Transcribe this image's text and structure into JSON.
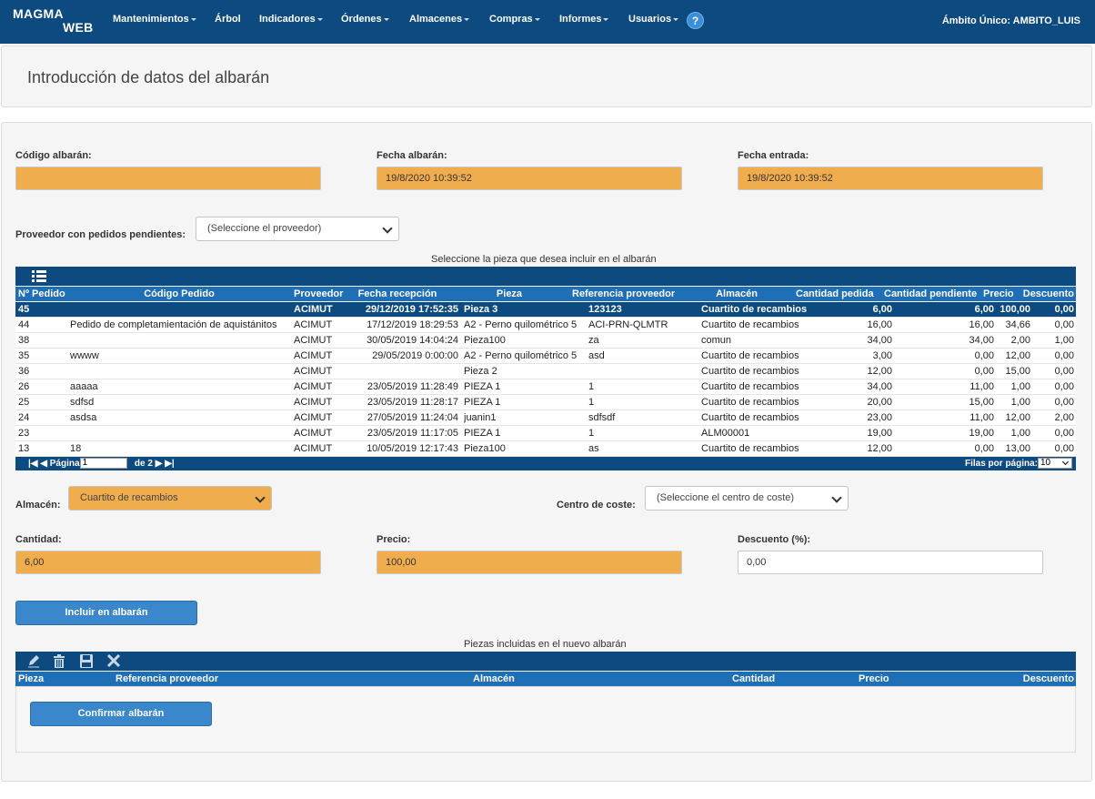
{
  "navbar": {
    "logo_line1": "MAGMA",
    "logo_line2": "WEB",
    "items": [
      "Mantenimientos",
      "Árbol",
      "Indicadores",
      "Órdenes",
      "Almacenes",
      "Compras",
      "Informes",
      "Usuarios"
    ],
    "help_label": "?",
    "scope": "Ámbito Único: AMBITO_LUIS"
  },
  "page": {
    "title": "Introducción de datos del albarán"
  },
  "form": {
    "codigo_label": "Código albarán:",
    "codigo_value": "",
    "fecha_albaran_label": "Fecha albarán:",
    "fecha_albaran_value": "19/8/2020 10:39:52",
    "fecha_entrada_label": "Fecha entrada:",
    "fecha_entrada_value": "19/8/2020 10:39:52",
    "proveedor_label": "Proveedor con pedidos pendientes:",
    "proveedor_value": "(Seleccione el proveedor)"
  },
  "pending_grid": {
    "caption": "Seleccione la pieza que desea incluir en el albarán",
    "toolbar_icon": "list-icon",
    "headers": [
      "Nº Pedido",
      "Código Pedido",
      "Proveedor",
      "Fecha recepción",
      "Pieza",
      "Referencia proveedor",
      "Almacén",
      "Cantidad pedida",
      "Cantidad pendiente",
      "Precio",
      "Descuento"
    ],
    "rows": [
      [
        "45",
        "",
        "ACIMUT",
        "29/12/2019 17:52:35",
        "Pieza 3",
        "123123",
        "Cuartito de recambios",
        "6,00",
        "6,00",
        "100,00",
        "0,00"
      ],
      [
        "44",
        "Pedido de completamientación de aquistánitos",
        "ACIMUT",
        "17/12/2019 18:29:53",
        "A2 - Perno quilométrico 5",
        "ACI-PRN-QLMTR",
        "Cuartito de recambios",
        "16,00",
        "16,00",
        "34,66",
        "0,00"
      ],
      [
        "38",
        "",
        "ACIMUT",
        "30/05/2019 14:04:24",
        "Pieza100",
        "za",
        "comun",
        "34,00",
        "34,00",
        "2,00",
        "1,00"
      ],
      [
        "35",
        "wwww",
        "ACIMUT",
        "29/05/2019 0:00:00",
        "A2 - Perno quilométrico 5",
        "asd",
        "Cuartito de recambios",
        "3,00",
        "0,00",
        "12,00",
        "0,00"
      ],
      [
        "36",
        "",
        "ACIMUT",
        "",
        "Pieza 2",
        "",
        "Cuartito de recambios",
        "12,00",
        "0,00",
        "15,00",
        "0,00"
      ],
      [
        "26",
        "aaaaa",
        "ACIMUT",
        "23/05/2019 11:28:49",
        "PIEZA 1",
        "1",
        "Cuartito de recambios",
        "34,00",
        "11,00",
        "1,00",
        "0,00"
      ],
      [
        "25",
        "sdfsd",
        "ACIMUT",
        "23/05/2019 11:28:17",
        "PIEZA 1",
        "1",
        "Cuartito de recambios",
        "20,00",
        "15,00",
        "1,00",
        "0,00"
      ],
      [
        "24",
        "asdsa",
        "ACIMUT",
        "27/05/2019 11:24:04",
        "juanin1",
        "sdfsdf",
        "Cuartito de recambios",
        "23,00",
        "11,00",
        "12,00",
        "2,00"
      ],
      [
        "23",
        "",
        "ACIMUT",
        "23/05/2019 11:17:05",
        "PIEZA 1",
        "1",
        "ALM00001",
        "19,00",
        "19,00",
        "1,00",
        "0,00"
      ],
      [
        "13",
        "18",
        "ACIMUT",
        "10/05/2019 12:17:43",
        "Pieza100",
        "as",
        "Cuartito de recambios",
        "12,00",
        "0,00",
        "13,00",
        "0,00"
      ]
    ],
    "pager": {
      "page_label": "Página",
      "page_value": "1",
      "of_label": "de 2",
      "rows_label": "Filas por página:",
      "rows_value": "10"
    }
  },
  "line": {
    "almacen_label": "Almacén:",
    "almacen_value": "Cuartito de recambios",
    "centro_label": "Centro de coste:",
    "centro_value": "(Seleccione el centro de coste)",
    "cantidad_label": "Cantidad:",
    "cantidad_value": "6,00",
    "precio_label": "Precio:",
    "precio_value": "100,00",
    "descuento_label": "Descuento (%):",
    "descuento_value": "0,00",
    "include_button": "Incluir en albarán"
  },
  "included_grid": {
    "caption": "Piezas incluidas en el nuevo albarán",
    "toolbar_icons": [
      "edit-icon",
      "delete-icon",
      "save-icon",
      "cancel-icon"
    ],
    "headers": [
      "Pieza",
      "Referencia proveedor",
      "Almacén",
      "Cantidad",
      "Precio",
      "Descuento"
    ],
    "confirm_button": "Confirmar albarán"
  },
  "colors": {
    "navbar": "#0c4a80",
    "header": "#1f6fb6",
    "input_highlight": "#f0ad4e",
    "button": "#3a87cc"
  }
}
